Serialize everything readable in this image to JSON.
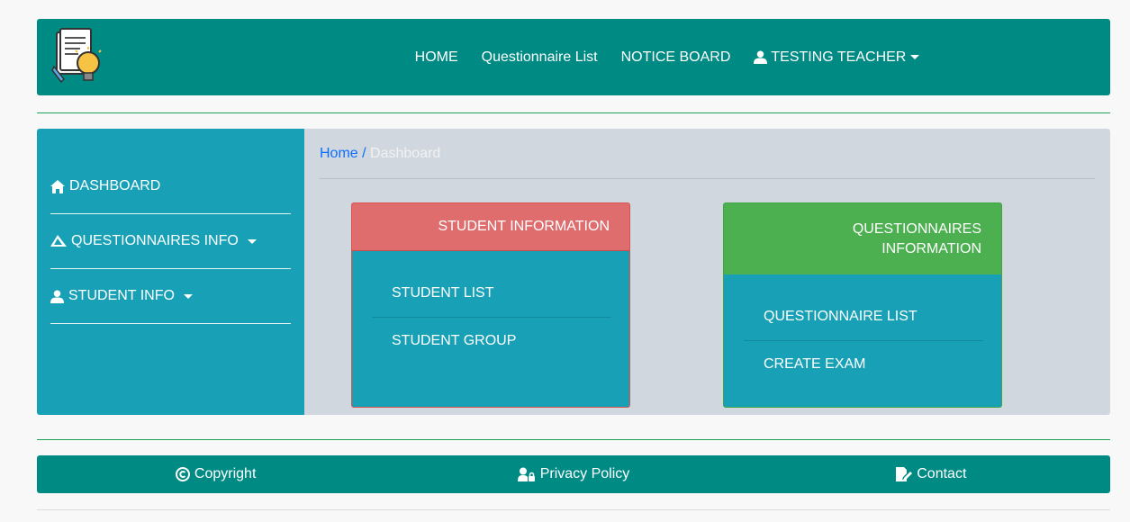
{
  "header": {
    "logo_icon": "document-lightbulb-logo",
    "nav": {
      "home": "HOME",
      "questionnaire_list": "Questionnaire List",
      "notice_board": "NOTICE BOARD",
      "user": "TESTING TEACHER"
    }
  },
  "sidebar": {
    "items": [
      {
        "label": "DASHBOARD",
        "icon": "home-icon"
      },
      {
        "label": "QUESTIONNAIRES INFO",
        "icon": "paper-plane-icon"
      },
      {
        "label": "STUDENT INFO",
        "icon": "user-icon"
      }
    ]
  },
  "breadcrumb": {
    "home": "Home",
    "separator": "/",
    "current": "Dashboard"
  },
  "cards": {
    "student": {
      "title": "STUDENT INFORMATION",
      "links": [
        "STUDENT LIST",
        "STUDENT GROUP"
      ]
    },
    "questionnaires": {
      "title_line1": "QUESTIONNAIRES",
      "title_line2": "INFORMATION",
      "links": [
        "QUESTIONNAIRE LIST",
        "CREATE EXAM"
      ]
    }
  },
  "footer": {
    "copyright": "Copyright",
    "privacy": "Privacy Policy",
    "contact": "Contact"
  },
  "colors": {
    "header_bg": "#008a84",
    "sidebar_bg": "#17a0b6",
    "card_red": "#df6d6d",
    "card_green": "#4caf50",
    "link_blue": "#0d6efd"
  }
}
